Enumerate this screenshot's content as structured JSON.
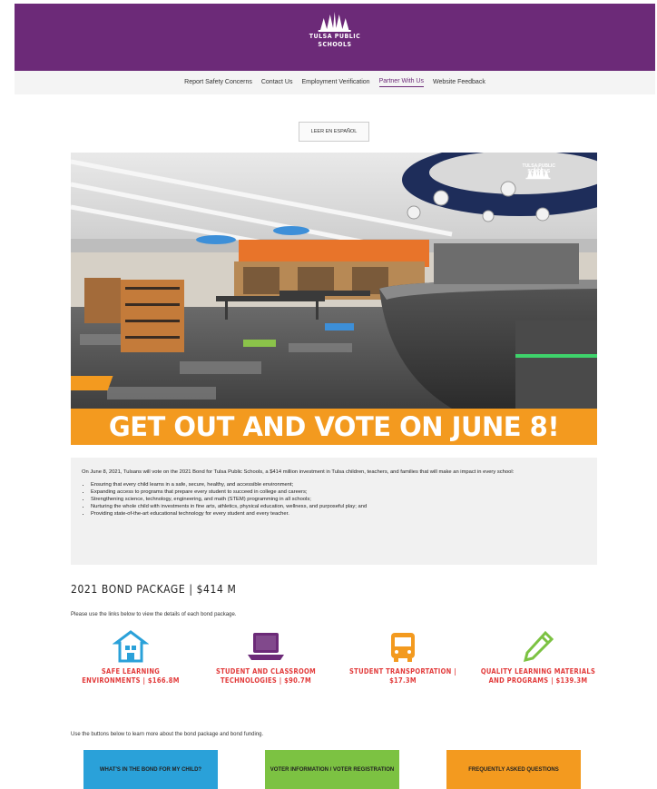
{
  "header": {
    "logo_line1": "TULSA PUBLIC",
    "logo_line2": "SCHOOLS",
    "color": "#6c2a78"
  },
  "nav": {
    "items": [
      "Report Safety Concerns",
      "Contact Us",
      "Employment Verification",
      "Partner With Us",
      "Website Feedback"
    ],
    "active_index": 3
  },
  "language_button": "LEER EN ESPAÑOL",
  "hero": {
    "banner": "GET OUT AND VOTE ON JUNE 8!",
    "logo_line1": "TULSA PUBLIC",
    "logo_line2": "SCHOOLS",
    "banner_color": "#f39a1f"
  },
  "intro": {
    "paragraph": "On June 8, 2021, Tulsans will vote on the 2021 Bond for Tulsa Public Schools, a $414 million investment in Tulsa children, teachers, and families that will make an impact in every school:",
    "bullets": [
      "Ensuring that every child learns in a safe, secure, healthy, and accessible environment;",
      "Expanding access to programs that prepare every student to succeed in college and careers;",
      "Strengthening science, technology, engineering, and math (STEM) programming in all schools;",
      "Nurturing the whole child with investments in fine arts, athletics, physical education, wellness, and purposeful play; and",
      "Providing state-of-the-art educational technology for every student and every teacher."
    ]
  },
  "package": {
    "title": "2021 BOND PACKAGE | $414 M",
    "subtitle": "Please use the links below to view the details of each bond package.",
    "items": [
      {
        "icon": "school-icon",
        "label": "SAFE LEARNING ENVIRONMENTS | $166.8M",
        "color": "#2aa1d9"
      },
      {
        "icon": "laptop-icon",
        "label": "STUDENT AND CLASSROOM TECHNOLOGIES | $90.7M",
        "color": "#6c2a78"
      },
      {
        "icon": "bus-icon",
        "label": "STUDENT TRANSPORTATION | $17.3M",
        "color": "#f39a1f"
      },
      {
        "icon": "pencil-icon",
        "label": "QUALITY LEARNING MATERIALS AND PROGRAMS | $139.3M",
        "color": "#7cc242"
      }
    ],
    "label_color": "#e23b3b"
  },
  "buttons_note": "Use the buttons below to learn more about the bond package and bond funding.",
  "cta_buttons": [
    {
      "label": "WHAT'S IN THE BOND FOR MY CHILD?",
      "color": "#2aa1d9"
    },
    {
      "label": "VOTER INFORMATION / VOTER REGISTRATION",
      "color": "#7cc242"
    },
    {
      "label": "FREQUENTLY ASKED QUESTIONS",
      "color": "#f39a1f"
    }
  ]
}
